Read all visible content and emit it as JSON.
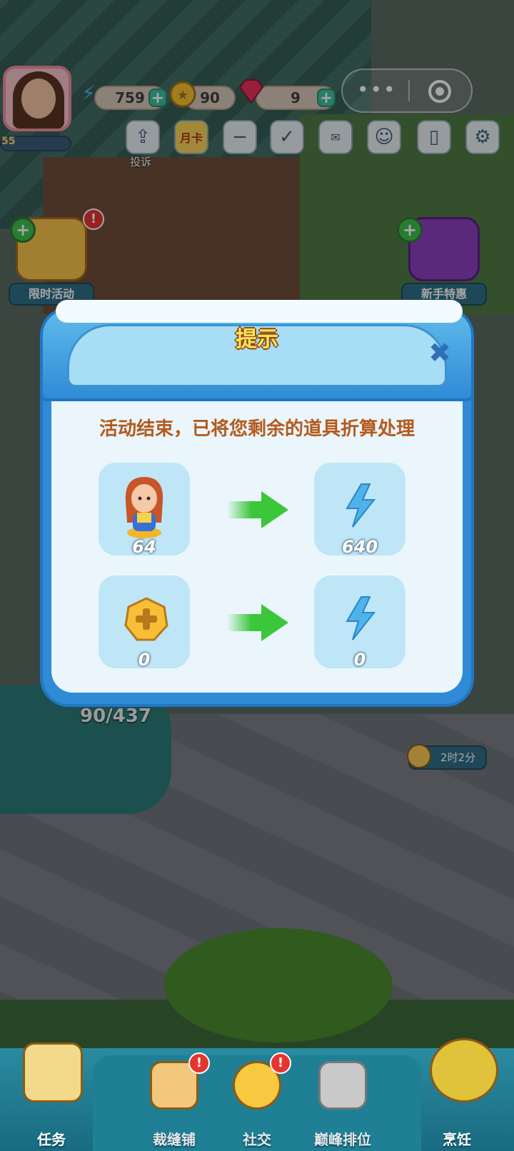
{
  "hud": {
    "energy": "759",
    "coins": "90",
    "gems": "9",
    "level": "55"
  },
  "top_icons": {
    "complaint_label": "投诉",
    "month_card_label": "月卡"
  },
  "side": {
    "left_event_label": "限时活动",
    "right_offer_label": "新手特惠",
    "timer": "2时2分",
    "progress": "90/437"
  },
  "dialog": {
    "title": "提示",
    "message": "活动结束，已将您剩余的道具折算处理",
    "rows": [
      {
        "from_item": "girl-figure-icon",
        "from_count": "64",
        "to_item": "energy-bolt-icon",
        "to_count": "640"
      },
      {
        "from_item": "coin-token-icon",
        "from_count": "0",
        "to_item": "energy-bolt-icon",
        "to_count": "0"
      }
    ]
  },
  "bottom_nav": {
    "items": [
      {
        "label": "任务"
      },
      {
        "label": "裁缝铺"
      },
      {
        "label": "社交"
      },
      {
        "label": "巅峰排位"
      },
      {
        "label": "烹饪"
      }
    ]
  },
  "colors": {
    "dialog_blue": "#2f8bd5",
    "title_yellow": "#ffe35a",
    "message_brown": "#b45a1d",
    "arrow_green": "#3cc63a"
  }
}
